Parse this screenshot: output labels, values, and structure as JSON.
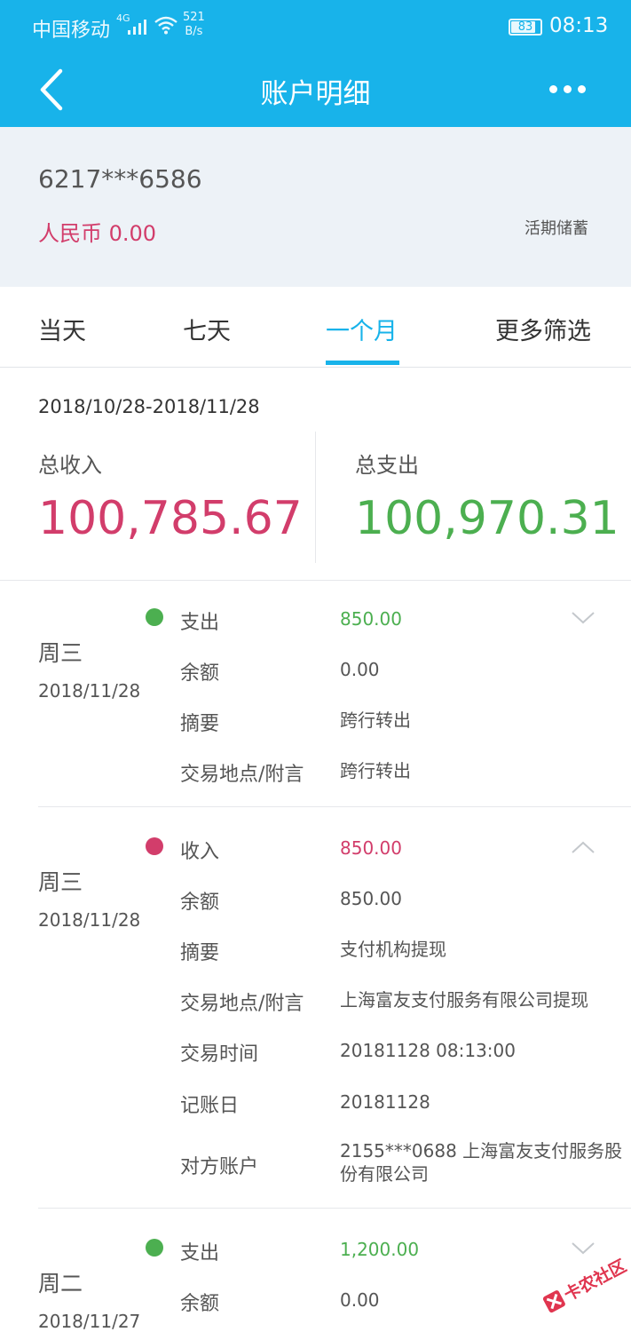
{
  "status_bar": {
    "carrier": "中国移动",
    "network": "4G",
    "speed_value": "521",
    "speed_unit": "B/s",
    "battery": "83",
    "time": "08:13"
  },
  "nav": {
    "title": "账户明细",
    "back_icon": "chevron-left-icon",
    "more_icon": "more-horizontal-icon"
  },
  "account": {
    "number": "6217***6586",
    "balance": "人民币 0.00",
    "type": "活期储蓄"
  },
  "tabs": [
    {
      "label": "当天",
      "active": false
    },
    {
      "label": "七天",
      "active": false
    },
    {
      "label": "一个月",
      "active": true
    },
    {
      "label": "更多筛选",
      "active": false
    }
  ],
  "summary": {
    "date_range": "2018/10/28-2018/11/28",
    "income_label": "总收入",
    "income_value": "100,785.67",
    "expense_label": "总支出",
    "expense_value": "100,970.31"
  },
  "colors": {
    "primary": "#18b3ea",
    "income": "#d23d6b",
    "expense": "#4caf50"
  },
  "transactions": [
    {
      "weekday": "周三",
      "date": "2018/11/28",
      "expanded": false,
      "type": "expense",
      "rows": [
        {
          "label": "支出",
          "value": "850.00"
        },
        {
          "label": "余额",
          "value": "0.00"
        },
        {
          "label": "摘要",
          "value": "跨行转出"
        },
        {
          "label": "交易地点/附言",
          "value": "跨行转出"
        }
      ]
    },
    {
      "weekday": "周三",
      "date": "2018/11/28",
      "expanded": true,
      "type": "income",
      "rows": [
        {
          "label": "收入",
          "value": "850.00"
        },
        {
          "label": "余额",
          "value": "850.00"
        },
        {
          "label": "摘要",
          "value": "支付机构提现"
        },
        {
          "label": "交易地点/附言",
          "value": "上海富友支付服务有限公司提现"
        },
        {
          "label": "交易时间",
          "value": "20181128 08:13:00"
        },
        {
          "label": "记账日",
          "value": "20181128"
        },
        {
          "label": "对方账户",
          "value": "2155***0688 上海富友支付服务股份有限公司"
        }
      ]
    },
    {
      "weekday": "周二",
      "date": "2018/11/27",
      "expanded": false,
      "type": "expense",
      "rows": [
        {
          "label": "支出",
          "value": "1,200.00"
        },
        {
          "label": "余额",
          "value": "0.00"
        }
      ]
    }
  ],
  "watermark": "卡农社区"
}
